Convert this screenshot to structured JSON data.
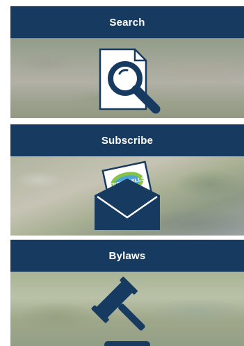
{
  "colors": {
    "banner": "#173b60",
    "icon": "#173b60",
    "text": "#ffffff"
  },
  "cards": [
    {
      "label": "Search",
      "icon": "magnifier-document-icon"
    },
    {
      "label": "Subscribe",
      "icon": "envelope-newsletter-icon",
      "envelope_text": "TRENT HILLS"
    },
    {
      "label": "Bylaws",
      "icon": "gavel-icon"
    }
  ]
}
